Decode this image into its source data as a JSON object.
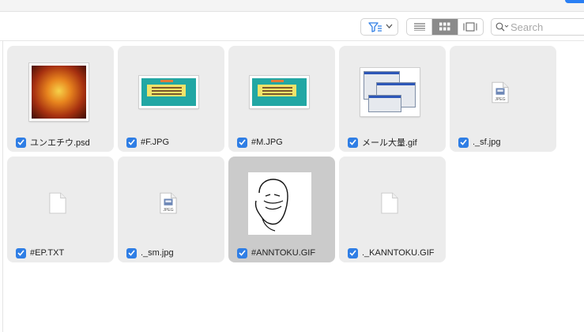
{
  "toolbar": {
    "filter_icon": "filter-icon",
    "view_modes": [
      "list-view-icon",
      "icon-view-icon",
      "gallery-view-icon"
    ],
    "active_view": "icon-view",
    "search": {
      "placeholder": "Search",
      "value": ""
    }
  },
  "files": [
    {
      "name": "ユンエチウ.psd",
      "thumb": "photo",
      "checked": true,
      "selected": false
    },
    {
      "name": "#F.JPG",
      "thumb": "banner",
      "checked": true,
      "selected": false
    },
    {
      "name": "#M.JPG",
      "thumb": "banner",
      "checked": true,
      "selected": false
    },
    {
      "name": "メール大量.gif",
      "thumb": "screenshot",
      "checked": true,
      "selected": false
    },
    {
      "name": "._sf.jpg",
      "thumb": "jpeg-doc",
      "checked": true,
      "selected": false
    },
    {
      "name": "#EP.TXT",
      "thumb": "blank-doc",
      "checked": true,
      "selected": false
    },
    {
      "name": "._sm.jpg",
      "thumb": "jpeg-doc",
      "checked": true,
      "selected": false
    },
    {
      "name": "#ANNTOKU.GIF",
      "thumb": "sketch",
      "checked": true,
      "selected": true
    },
    {
      "name": "._KANNTOKU.GIF",
      "thumb": "blank-doc",
      "checked": true,
      "selected": false
    }
  ],
  "doc_badge": "JPEG",
  "colors": {
    "accent": "#2f7ee5",
    "tile": "#ececec",
    "tile_selected": "#cbcbcb"
  }
}
